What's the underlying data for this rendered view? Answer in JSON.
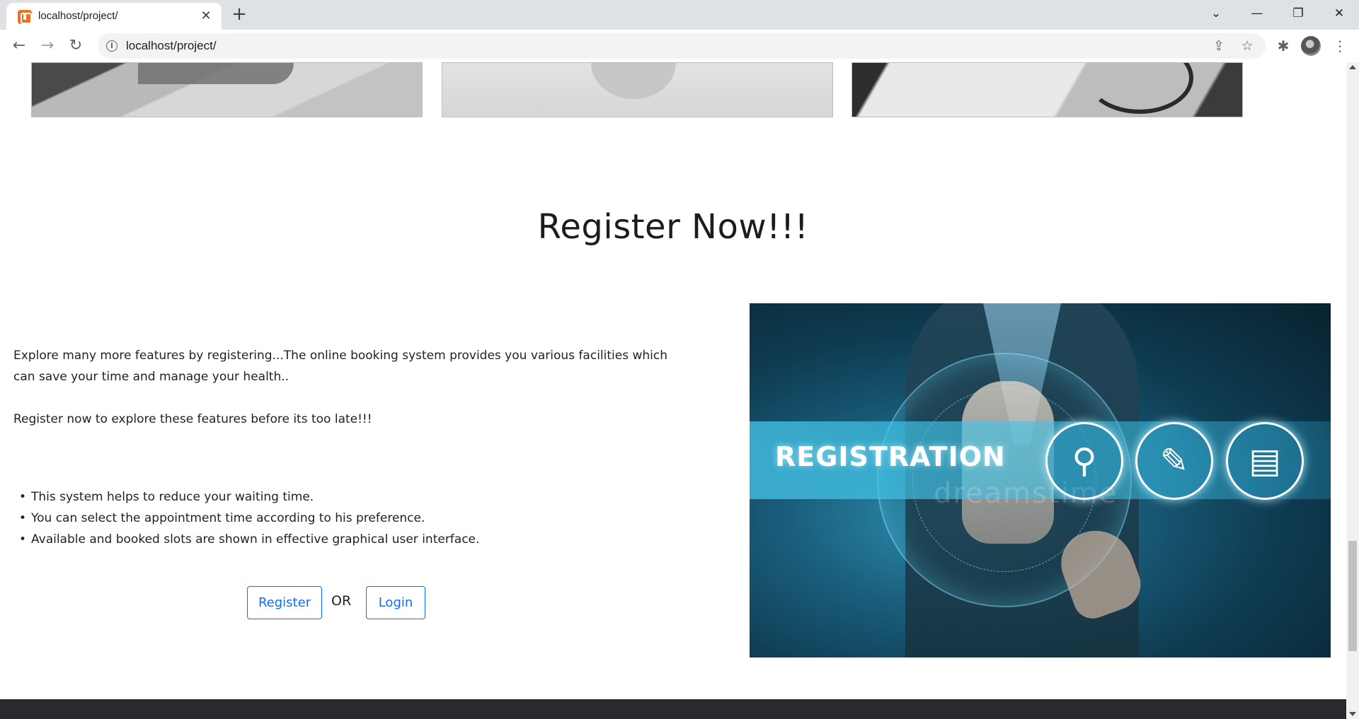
{
  "browser": {
    "tab_title": "localhost/project/",
    "tab_close": "✕",
    "new_tab": "+",
    "url": "localhost/project/",
    "icons": [
      "favicon-icon",
      "back-icon",
      "forward-icon",
      "reload-icon",
      "info-icon",
      "share-icon",
      "star-icon",
      "extensions-icon",
      "menu-icon"
    ],
    "glyphs": {
      "dropdown": "⌄",
      "minimize": "—",
      "restore": "❐",
      "close": "✕",
      "back": "←",
      "forward": "→",
      "reload": "↻",
      "info": "i",
      "share": "⇪",
      "star": "☆",
      "extensions": "✱",
      "menu": "⋮"
    }
  },
  "page": {
    "section_title": "Register Now!!!",
    "paragraph_1": "Explore many more features by registering...The online booking system provides you various facilities which can save your time and manage your health..",
    "paragraph_2": "Register now to explore these features before its too late!!!",
    "features": [
      "This system helps to reduce your waiting time.",
      "You can select the appointment time according to his preference.",
      "Available and booked slots are shown in effective graphical user interface."
    ],
    "register_button": "Register",
    "or_text": "OR",
    "login_button": "Login",
    "hero": {
      "banner_text": "REGISTRATION",
      "watermark": "dreamstime",
      "circle_icons": [
        "search-person-icon",
        "document-edit-icon",
        "id-card-icon"
      ],
      "circle_glyphs": [
        "⚲",
        "✎",
        "▤"
      ]
    }
  },
  "colors": {
    "accent": "#0d6efd",
    "footer": "#2a2a2e",
    "chrome": "#dee1e6"
  }
}
